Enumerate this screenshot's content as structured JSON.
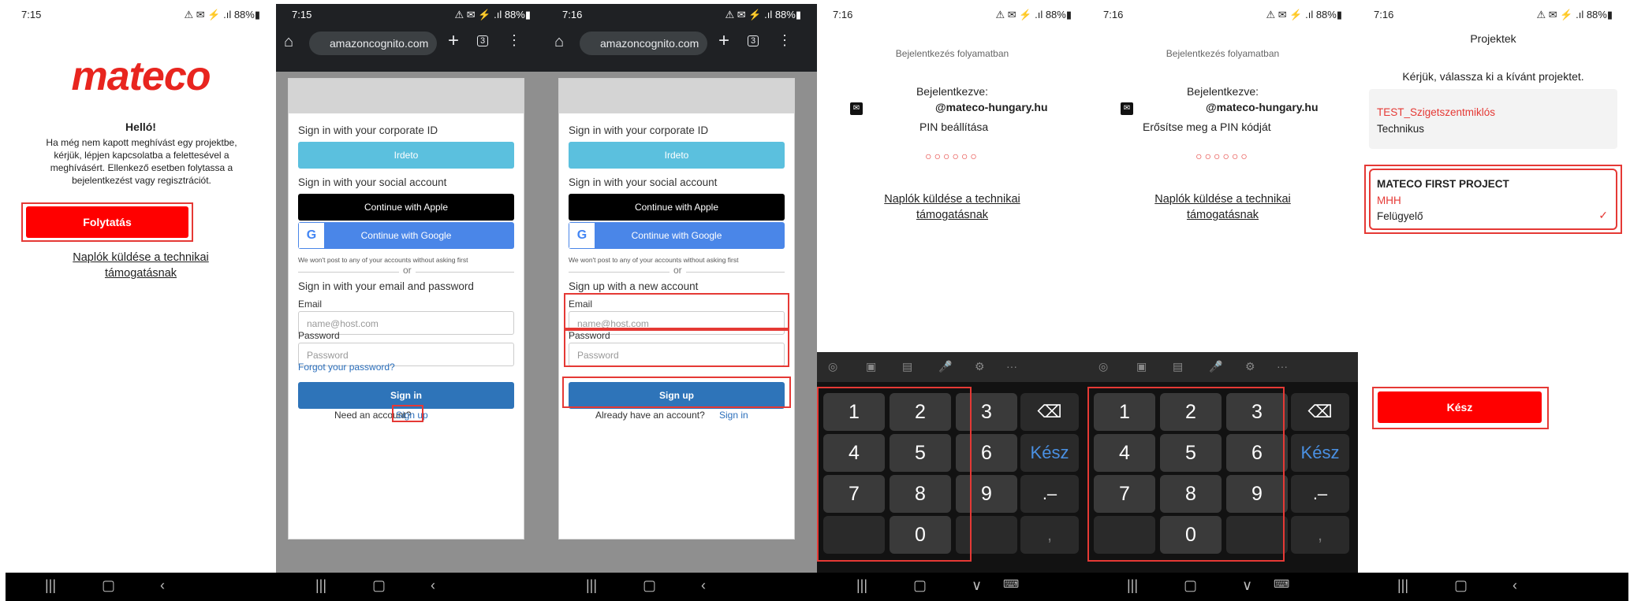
{
  "status": {
    "time1": "7:15",
    "time2": "7:16",
    "icons": "⚠ ✉ ⚡ .ıl 88%▮"
  },
  "p1": {
    "logo": "mateco",
    "hello": "Helló!",
    "body": "Ha még nem kapott meghívást egy projektbe, kérjük, lépjen kapcsolatba a felettesével a meghívásért. Ellenkező esetben folytassa a bejelentkezést vagy regisztrációt.",
    "continue": "Folytatás",
    "logs": "Naplók küldése a technikai támogatásnak"
  },
  "browser": {
    "url": "amazoncognito.com",
    "tabs": "3",
    "corp": "Sign in with your corporate ID",
    "irdeto": "Irdeto",
    "social": "Sign in with your social account",
    "apple": "Continue with Apple",
    "google": "Continue with Google",
    "nopost": "We won't post to any of your accounts without asking first",
    "or": "or",
    "email_pw": "Sign in with your email and password",
    "signup_new": "Sign up with a new account",
    "email": "Email",
    "email_ph": "name@host.com",
    "password": "Password",
    "pw_ph": "Password",
    "forgot": "Forgot your password?",
    "signin": "Sign in",
    "signup": "Sign up",
    "need": "Need an account?",
    "signup_link": "Sign up",
    "already": "Already have an account?",
    "signin_link": "Sign in"
  },
  "pin": {
    "progress": "Bejelentkezés folyamatban",
    "logged": "Bejelentkezve:",
    "domain": "@mateco-hungary.hu",
    "set": "PIN beállítása",
    "confirm": "Erősítse meg a PIN kódját",
    "circles": "○○○○○○",
    "logs": "Naplók küldése a technikai támogatásnak",
    "done": "Kész",
    "dot": ".–",
    "comma": ","
  },
  "keys": [
    "1",
    "2",
    "3",
    "4",
    "5",
    "6",
    "7",
    "8",
    "9",
    "0"
  ],
  "proj": {
    "title": "Projektek",
    "prompt": "Kérjük, válassza ki a kívánt projektet.",
    "p1_name": "TEST_Szigetszentmiklós",
    "p1_role": "Technikus",
    "p2_name": "MATECO FIRST PROJECT",
    "p2_code": "MHH",
    "p2_role": "Felügyelő",
    "done": "Kész"
  }
}
